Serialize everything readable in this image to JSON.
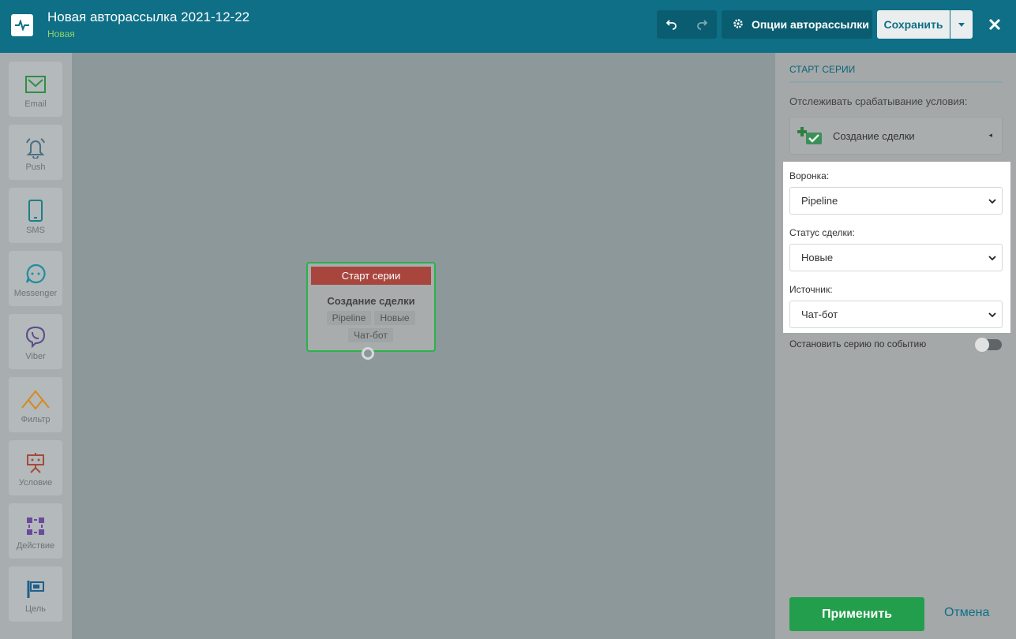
{
  "header": {
    "title": "Новая авторассылка 2021-12-22",
    "status": "Новая",
    "options_label": "Опции авторассылки",
    "save_label": "Сохранить",
    "colors": {
      "bar": "#0e6f86",
      "status": "#8fd46b"
    }
  },
  "toolbar": {
    "items": [
      {
        "label": "Email",
        "icon": "envelope-icon"
      },
      {
        "label": "Push",
        "icon": "bell-icon"
      },
      {
        "label": "SMS",
        "icon": "phone-icon"
      },
      {
        "label": "Messenger",
        "icon": "chat-icon"
      },
      {
        "label": "Viber",
        "icon": "viber-icon"
      },
      {
        "label": "Фильтр",
        "icon": "filter-icon"
      },
      {
        "label": "Условие",
        "icon": "condition-icon"
      },
      {
        "label": "Действие",
        "icon": "action-icon"
      },
      {
        "label": "Цель",
        "icon": "flag-icon"
      }
    ]
  },
  "node": {
    "header": "Старт серии",
    "title": "Создание сделки",
    "tags": [
      "Pipeline",
      "Новые",
      "Чат-бот"
    ]
  },
  "panel": {
    "heading": "СТАРТ СЕРИИ",
    "track_label": "Отслеживать срабатывание условия:",
    "event": "Создание сделки",
    "fields": [
      {
        "label": "Воронка:",
        "value": "Pipeline"
      },
      {
        "label": "Статус сделки:",
        "value": "Новые"
      },
      {
        "label": "Источник:",
        "value": "Чат-бот"
      }
    ],
    "stop_label": "Остановить серию по событию",
    "stop_enabled": false,
    "apply_label": "Применить",
    "cancel_label": "Отмена"
  }
}
